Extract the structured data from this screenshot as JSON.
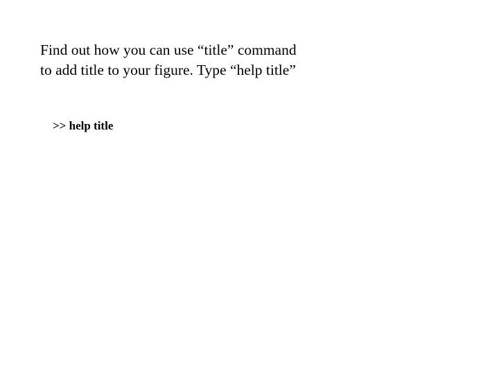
{
  "instruction": {
    "line1": "Find out how you can use “title” command",
    "line2": "to add title to your figure. Type “help title”"
  },
  "command": {
    "prompt": ">> help title"
  }
}
